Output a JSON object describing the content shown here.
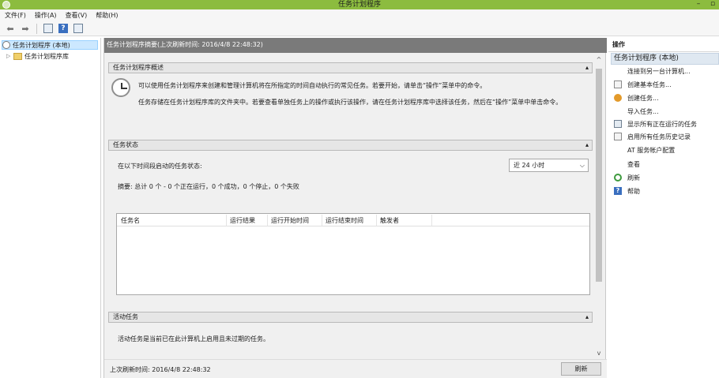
{
  "window": {
    "title": "任务计划程序",
    "minimize_glyph": "–",
    "maximize_glyph": "▫"
  },
  "menu": [
    "文件(F)",
    "操作(A)",
    "查看(V)",
    "帮助(H)"
  ],
  "toolbar": {
    "back_glyph": "⬅",
    "forward_glyph": "➡",
    "icons": [
      "back-arrow-icon",
      "forward-arrow-icon",
      "show-hide-console-tree-icon",
      "help-icon",
      "show-hide-action-pane-icon"
    ]
  },
  "tree": {
    "root": "任务计划程序 (本地)",
    "library": "任务计划程序库"
  },
  "center": {
    "header": "任务计划程序摘要(上次刷新时间: 2016/4/8 22:48:32)",
    "overview": {
      "title": "任务计划程序概述",
      "para1": "可以使用任务计划程序来创建和管理计算机将在所指定的时间自动执行的常见任务。若要开始，请单击“操作”菜单中的命令。",
      "para2": "任务存储在任务计划程序库的文件夹中。若要查看单独任务上的操作或执行该操作，请在任务计划程序库中选择该任务，然后在“操作”菜单中单击命令。"
    },
    "status": {
      "title": "任务状态",
      "range_label": "在以下时间段启动的任务状态:",
      "range_value": "近 24 小时",
      "summary": "摘要: 总计 0 个 - 0 个正在运行，0 个成功，0 个停止，0 个失败",
      "columns": [
        "任务名",
        "运行结果",
        "运行开始时间",
        "运行结束时间",
        "触发者"
      ]
    },
    "active": {
      "title": "活动任务",
      "text": "活动任务是当前已在此计算机上启用且未过期的任务。"
    },
    "collapse_glyph": "▴",
    "scroll_up": "^",
    "scroll_down": "v",
    "footer": {
      "last_refresh": "上次刷新时间: 2016/4/8 22:48:32",
      "refresh_button": "刷新"
    }
  },
  "actions": {
    "header": "操作",
    "group": "任务计划程序 (本地)",
    "items": [
      {
        "label": "连接到另一台计算机...",
        "icon": "none"
      },
      {
        "label": "创建基本任务...",
        "icon": "create-basic-task-icon"
      },
      {
        "label": "创建任务...",
        "icon": "create-task-icon"
      },
      {
        "label": "导入任务...",
        "icon": "none"
      },
      {
        "label": "显示所有正在运行的任务",
        "icon": "running-tasks-icon"
      },
      {
        "label": "启用所有任务历史记录",
        "icon": "history-icon"
      },
      {
        "label": "AT 服务帐户配置",
        "icon": "none"
      },
      {
        "label": "查看",
        "icon": "none"
      },
      {
        "label": "刷新",
        "icon": "refresh-icon"
      },
      {
        "label": "帮助",
        "icon": "help-icon"
      }
    ]
  },
  "colors": {
    "titlebar": "#8cbc3f",
    "center_header": "#7a7a7a",
    "selection": "#cce8ff",
    "action_group": "#dfe8f1"
  }
}
